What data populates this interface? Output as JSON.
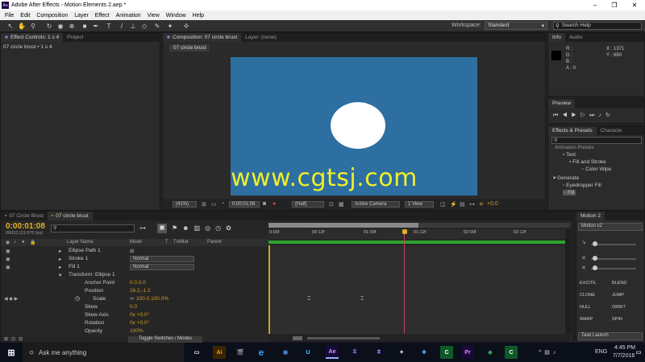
{
  "titlebar": {
    "title": "Adobe After Effects - Motion Elements 2.aep *",
    "min": "–",
    "max": "❐",
    "close": "✕",
    "appicon": "Ae"
  },
  "menu": [
    "File",
    "Edit",
    "Composition",
    "Layer",
    "Effect",
    "Animation",
    "View",
    "Window",
    "Help"
  ],
  "toolbar": {
    "workspace_label": "Workspace:",
    "workspace_value": "Standard",
    "search_placeholder": "Search Help"
  },
  "effects_panel": {
    "tab1": "Effect Controls: 1 s 4",
    "tab2": "Project",
    "layer_label": "07 circle brust • 1 s 4"
  },
  "comp_panel": {
    "tab1": "Composition: 07 circle brust",
    "tab2": "Layer: (none)",
    "breadcrumb": "07 circle brust",
    "footer": {
      "zoom": "(41%)",
      "timecode": "0;00;01;08",
      "resolution": "(Half)",
      "camera": "Active Camera",
      "view": "1 View",
      "exposure": "+0.0"
    }
  },
  "watermark": "www.cgtsj.com",
  "info_panel": {
    "tab1": "Info",
    "tab2": "Audio",
    "r": "R :",
    "g": "G :",
    "b": "B :",
    "a": "A : 0",
    "x": "X : 1371",
    "y": "Y : 690"
  },
  "preview_panel": {
    "tab": "Preview"
  },
  "effects_presets": {
    "tab1": "Effects & Presets",
    "tab2": "Characte",
    "items": [
      "Animation Presets",
      "Text",
      "Fill and Stroke",
      "Color Wipe",
      "Generate",
      "Eyedropper Fill",
      "Fill"
    ]
  },
  "timeline": {
    "tabs": [
      "07 Circle Brust",
      "07 circle brust"
    ],
    "timecode": "0:00:01:08",
    "fps": "00032 (23.976 fps)",
    "headers": {
      "layer_name": "Layer Name",
      "mode": "Mode",
      "t": "T",
      "trkmat": "TrkMat",
      "parent": "Parent"
    },
    "ruler": [
      "0:00f",
      "00:12f",
      "01:00f",
      "01:12f",
      "02:00f",
      "02:12f"
    ],
    "rows": [
      {
        "name": "Ellipse Path 1",
        "mode": ""
      },
      {
        "name": "Stroke 1",
        "mode": "Normal"
      },
      {
        "name": "Fill 1",
        "mode": "Normal"
      },
      {
        "name": "Transform: Ellipse 1",
        "mode": ""
      }
    ],
    "props": [
      {
        "name": "Anchor Point",
        "value": "0.0,0.0"
      },
      {
        "name": "Position",
        "value": "26.2,-1.2"
      },
      {
        "name": "Scale",
        "value": "100.0,100.0%"
      },
      {
        "name": "Skew",
        "value": "0.0"
      },
      {
        "name": "Skew Axis",
        "value": "0x +0.0°"
      },
      {
        "name": "Rotation",
        "value": "0x +0.0°"
      },
      {
        "name": "Opacity",
        "value": "100%"
      }
    ],
    "toggle": "Toggle Switches / Modes"
  },
  "motion_panel": {
    "tab": "Motion 2",
    "version": "Motion v2",
    "buttons": [
      "EXCITE",
      "BLEND",
      "CLONE",
      "JUMP",
      "NULL",
      "ORBIT",
      "WARP",
      "SPIN"
    ],
    "task": "Task Launch"
  },
  "taskbar": {
    "search": "Ask me anything",
    "lang": "ENG",
    "time": "4:45 PM",
    "date": "7/7/2016"
  },
  "colors": {
    "canvas": "#2d6fa0",
    "watermark": "#f2ee2a",
    "keyframe": "#c04060",
    "playhead": "#d0a020"
  }
}
